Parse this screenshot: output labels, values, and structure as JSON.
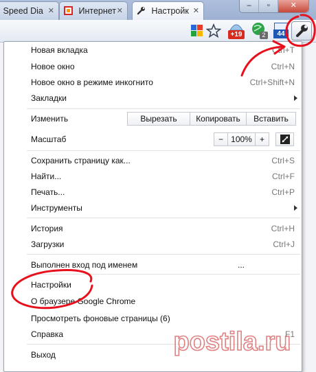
{
  "browser": {
    "tabs": [
      {
        "title": "Speed Dia",
        "icon": "speed-dial-icon"
      },
      {
        "title": "Интернет",
        "icon": "page-favicon"
      },
      {
        "title": "Настройк",
        "icon": "wrench-icon"
      }
    ],
    "toolbar_icons": [
      "apps-icon",
      "star-icon",
      "mail-badge-icon",
      "green-globe-icon",
      "calendar-icon",
      "wrench-icon"
    ],
    "badges": {
      "mail": "+19",
      "globe": "2",
      "calendar": "44"
    }
  },
  "menu": {
    "items": [
      {
        "label": "Новая вкладка",
        "shortcut": "Ctrl+T"
      },
      {
        "label": "Новое окно",
        "shortcut": "Ctrl+N"
      },
      {
        "label": "Новое окно в режиме инкогнито",
        "shortcut": "Ctrl+Shift+N"
      },
      {
        "label": "Закладки",
        "submenu": true
      },
      {
        "label": "Изменить"
      },
      {
        "label": "Масштаб"
      },
      {
        "label": "Сохранить страницу как...",
        "shortcut": "Ctrl+S"
      },
      {
        "label": "Найти...",
        "shortcut": "Ctrl+F"
      },
      {
        "label": "Печать...",
        "shortcut": "Ctrl+P"
      },
      {
        "label": "Инструменты",
        "submenu": true
      },
      {
        "label": "История",
        "shortcut": "Ctrl+H"
      },
      {
        "label": "Загрузки",
        "shortcut": "Ctrl+J"
      },
      {
        "label": "Выполнен вход под именем"
      },
      {
        "label": "Настройки"
      },
      {
        "label": "О браузере Google Chrome"
      },
      {
        "label": "Просмотреть фоновые страницы (6)"
      },
      {
        "label": "Справка",
        "shortcut": "F1"
      },
      {
        "label": "Выход"
      }
    ],
    "edit_buttons": {
      "cut": "Вырезать",
      "copy": "Копировать",
      "paste": "Вставить"
    },
    "zoom": {
      "minus": "−",
      "value": "100%",
      "plus": "+"
    },
    "signed_in_ellipsis": "..."
  },
  "watermark": {
    "text": "postila.ru"
  },
  "annotation_color": "#e8101c"
}
